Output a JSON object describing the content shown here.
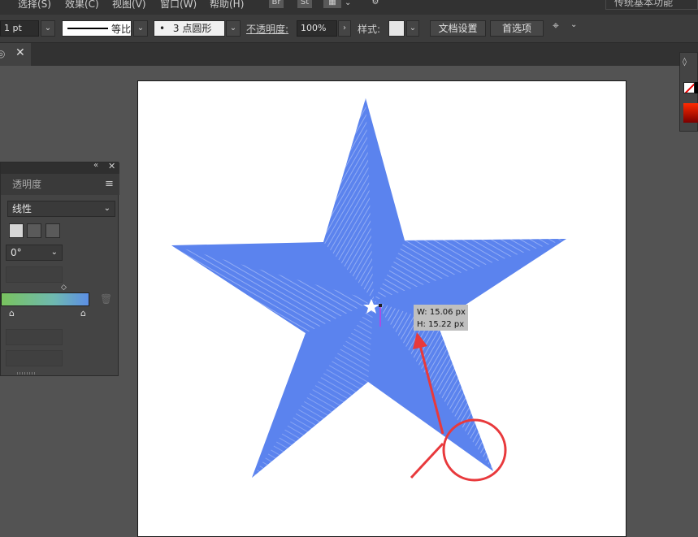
{
  "menu": {
    "items": [
      "选择(S)",
      "效果(C)",
      "视图(V)",
      "窗口(W)",
      "帮助(H)"
    ],
    "bridge_label": "Br",
    "stock_label": "St",
    "workspace": "传统基本功能"
  },
  "control_bar": {
    "stroke_weight": "1 pt",
    "profile_label": "等比",
    "brush_value": "3 点圆形",
    "opacity_label": "不透明度:",
    "opacity_value": "100%",
    "style_label": "样式:",
    "doc_setup_label": "文档设置",
    "preferences_label": "首选项"
  },
  "gradient_panel": {
    "tab_label": "透明度",
    "type_value": "线性",
    "angle_value": "0°"
  },
  "tooltip": {
    "w": "W: 15.06 px",
    "h": "H: 15.22 px"
  },
  "colors": {
    "star": "#5b83ee",
    "annotation": "#e8393c"
  }
}
